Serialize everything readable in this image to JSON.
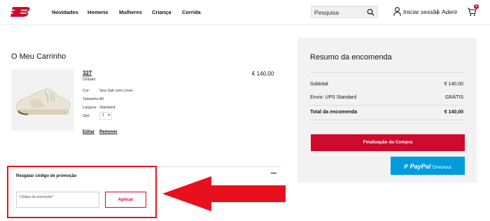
{
  "header": {
    "logo_icon": "new-balance-logo-icon",
    "nav": [
      "Novidades",
      "Homens",
      "Mulheres",
      "Criança",
      "Corrida"
    ],
    "search_placeholder": "Pesquisa",
    "login": "Iniciar sessão",
    "separator": "|",
    "register": "Aderir",
    "cart_count": "1"
  },
  "cart": {
    "title": "O Meu Carrinho",
    "item": {
      "name": "327",
      "gender": "Unisex",
      "price": "€ 140,00",
      "attributes": [
        {
          "label": "Cor:",
          "value": "Sea Salt com Linen"
        },
        {
          "label": "Tamanho:",
          "value": "40"
        },
        {
          "label": "Largura:",
          "value": "Standard"
        }
      ],
      "qty_label": "Qtd:",
      "qty_value": "1",
      "edit": "Editar",
      "remove": "Remover"
    }
  },
  "promo": {
    "title": "Resgatar código de promoção",
    "placeholder": "Código de promoção*",
    "apply": "Aplicar"
  },
  "summary": {
    "title": "Resumo da encomenda",
    "subtotal_label": "Subtotal",
    "subtotal_value": "€ 140,00",
    "shipping_label": "Envio: UPS Standard",
    "shipping_value": "GRÁTIS",
    "total_label": "Total da encomenda",
    "total_value": "€ 140,00",
    "checkout": "Finalização da Compra",
    "paypal_word": "PayPal",
    "paypal_checkout": "Checkout"
  },
  "colors": {
    "brand_red": "#cf0a2c",
    "annotation_red": "#e8101d",
    "paypal_blue": "#009cde"
  }
}
